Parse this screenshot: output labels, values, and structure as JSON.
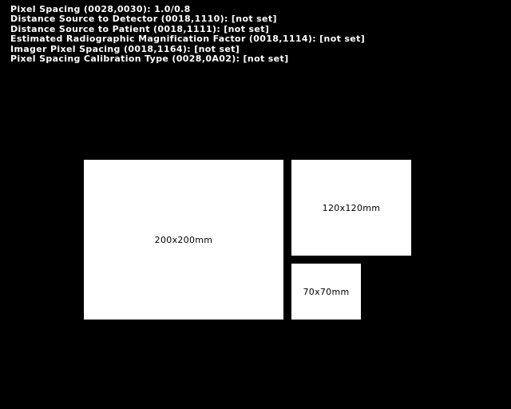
{
  "overlay": {
    "lines": [
      "Pixel Spacing (0028,0030): 1.0/0.8",
      "Distance Source to Detector (0018,1110): [not set]",
      "Distance Source to Patient (0018,1111): [not set]",
      "Estimated Radiographic Magnification Factor (0018,1114): [not set]",
      "Imager Pixel Spacing (0018,1164): [not set]",
      "Pixel Spacing Calibration Type (0028,0A02): [not set]"
    ]
  },
  "squares": {
    "large_label": "200x200mm",
    "medium_label": "120x120mm",
    "small_label": "70x70mm"
  },
  "colors": {
    "background": "#000000",
    "overlay_text": "#ffffff",
    "square_fill": "#ffffff",
    "square_text": "#000000"
  }
}
